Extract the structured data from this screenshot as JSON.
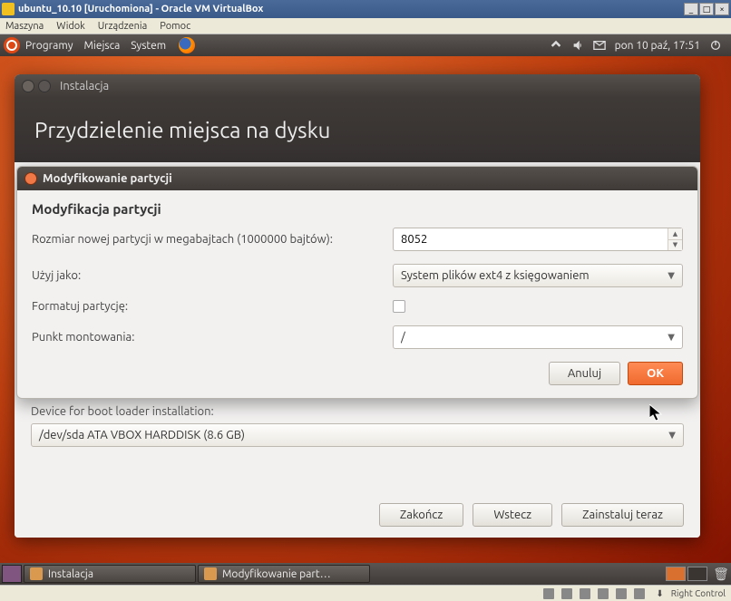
{
  "vbox": {
    "title": "ubuntu_10.10 [Uruchomiona] - Oracle VM VirtualBox",
    "menu": [
      "Maszyna",
      "Widok",
      "Urządzenia",
      "Pomoc"
    ],
    "status_key": "Right Control"
  },
  "gnome": {
    "menus": [
      "Programy",
      "Miejsca",
      "System"
    ],
    "clock": "pon 10 paź, 17:51"
  },
  "installer": {
    "window_title": "Instalacja",
    "header": "Przydzielenie miejsca na dysku",
    "bootloader_label": "Device for boot loader installation:",
    "bootloader_value": "/dev/sda ATA VBOX HARDDISK (8.6 GB)",
    "btn_quit": "Zakończ",
    "btn_back": "Wstecz",
    "btn_install": "Zainstaluj teraz"
  },
  "modal": {
    "title": "Modyfikowanie partycji",
    "heading": "Modyfikacja partycji",
    "size_label": "Rozmiar nowej partycji w megabajtach (1000000 bajtów):",
    "size_value": "8052",
    "use_as_label": "Użyj jako:",
    "use_as_value": "System plików ext4 z księgowaniem",
    "format_label": "Formatuj partycję:",
    "mount_label": "Punkt montowania:",
    "mount_value": "/",
    "btn_cancel": "Anuluj",
    "btn_ok": "OK"
  },
  "bottom_panel": {
    "task1": "Instalacja",
    "task2": "Modyfikowanie part…"
  }
}
